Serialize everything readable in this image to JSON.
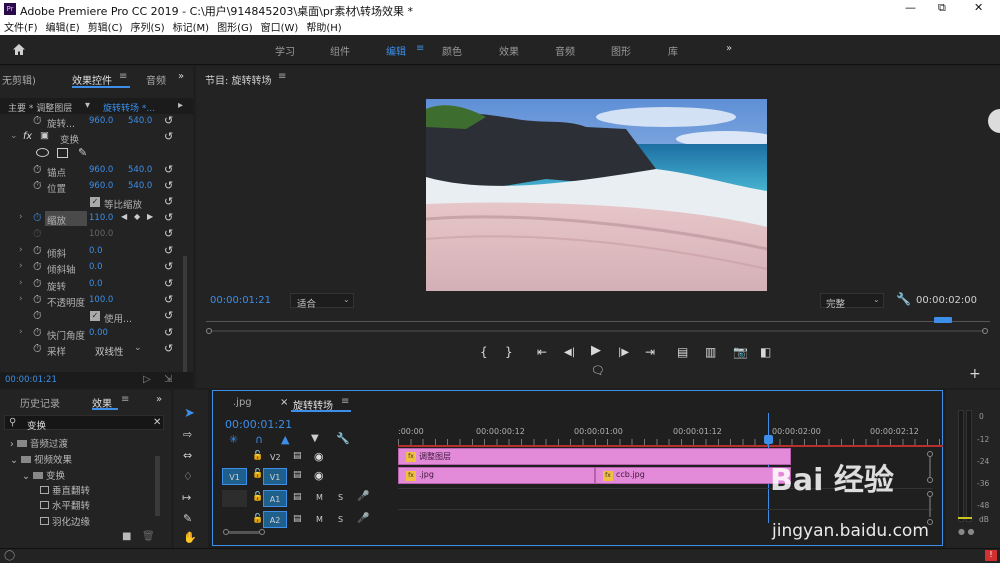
{
  "window": {
    "title": "Adobe Premiere Pro CC 2019 - C:\\用户\\914845203\\桌面\\pr素材\\转场效果 *",
    "logo": "Pr"
  },
  "menu": [
    "文件(F)",
    "编辑(E)",
    "剪辑(C)",
    "序列(S)",
    "标记(M)",
    "图形(G)",
    "窗口(W)",
    "帮助(H)"
  ],
  "workspaces": {
    "items": [
      "学习",
      "组件",
      "编辑",
      "颜色",
      "效果",
      "音频",
      "图形",
      "库"
    ],
    "active": "编辑",
    "more": "»"
  },
  "effect_controls": {
    "tabs": {
      "left": "无剪辑)",
      "active": "效果控件",
      "right": "音频"
    },
    "source_label": "主要 * 调整图层",
    "clip_label": "旋转转场 *...",
    "rows": {
      "rotate_top": {
        "label": "旋转...",
        "v1": "960.0",
        "v2": "540.0"
      },
      "transform": {
        "label": "变换",
        "fx": "fx"
      },
      "anchor": {
        "label": "锚点",
        "v1": "960.0",
        "v2": "540.0"
      },
      "position": {
        "label": "位置",
        "v1": "960.0",
        "v2": "540.0"
      },
      "uniform_scale": {
        "label": "等比缩放"
      },
      "scale": {
        "label": "缩放",
        "v1": "110.0"
      },
      "scale_w": {
        "v1": "100.0"
      },
      "skew": {
        "label": "倾斜",
        "v1": "0.0"
      },
      "skew_axis": {
        "label": "倾斜轴",
        "v1": "0.0"
      },
      "rotation": {
        "label": "旋转",
        "v1": "0.0"
      },
      "opacity": {
        "label": "不透明度",
        "v1": "100.0"
      },
      "use_comp": {
        "label": "使用..."
      },
      "shutter": {
        "label": "快门角度",
        "v1": "0.00"
      },
      "sampling": {
        "label": "采样",
        "value": "双线性"
      }
    },
    "timecode": "00:00:01:21"
  },
  "program_monitor": {
    "title": "节目: 旋转转场",
    "timecode_left": "00:00:01:21",
    "fit": "适合",
    "quality": "完整",
    "timecode_right": "00:00:02:00"
  },
  "project_panel": {
    "tabs": {
      "history": "历史记录",
      "effects": "效果"
    },
    "search_value": "变换",
    "tree": [
      "音频过渡",
      "视频效果",
      "变换",
      "垂直翻转",
      "水平翻转",
      "羽化边缘"
    ]
  },
  "timeline": {
    "tabs": {
      "first": ".jpg",
      "active": "旋转转场"
    },
    "timecode": "00:00:01:21",
    "ruler": [
      ":00:00",
      "00:00:00:12",
      "00:00:01:00",
      "00:00:01:12",
      "00:00:02:00",
      "00:00:02:12"
    ],
    "tracks": {
      "v2": "V2",
      "v1_src": "V1",
      "v1": "V1",
      "a1_src": "A1",
      "a1": "A1",
      "a2": "A2",
      "m": "M",
      "s": "S"
    },
    "clips": {
      "adjust": "调整图层",
      "jpg": ".jpg",
      "ccb": "ccb.jpg",
      "fx": "fx"
    }
  },
  "audio_meter": {
    "labels": [
      "0",
      "-12",
      "-24",
      "-36",
      "-48",
      "dB"
    ]
  },
  "watermark": {
    "brand": "Bai 经验",
    "url": "jingyan.baidu.com"
  }
}
